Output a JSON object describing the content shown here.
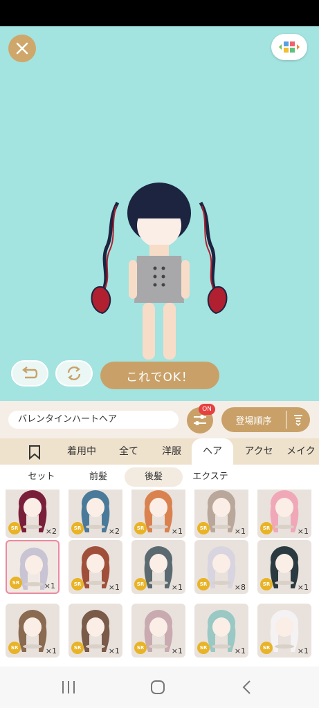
{
  "colors": {
    "stage_bg": "#a3e3e0",
    "gold": "#c9a168",
    "panel_bg": "#f5eee6",
    "sr_badge": "#e8b326",
    "on_badge": "#e64040"
  },
  "stage": {
    "close_icon": "close-icon",
    "catalog_icon": "palette-icon",
    "undo_icon": "undo-icon",
    "reset_icon": "refresh-icon",
    "ok_label": "これでOK！"
  },
  "toolbar": {
    "item_name": "バレンタインハートヘア",
    "filter_badge": "ON",
    "sort_label": "登場順序"
  },
  "category_tabs": [
    {
      "label": "",
      "icon": "bookmark-icon"
    },
    {
      "label": "着用中"
    },
    {
      "label": "全て"
    },
    {
      "label": "洋服"
    },
    {
      "label": "ヘア"
    },
    {
      "label": "アクセ"
    },
    {
      "label": "メイク"
    }
  ],
  "sub_tabs": [
    {
      "label": "セット"
    },
    {
      "label": "前髪"
    },
    {
      "label": "後髪"
    },
    {
      "label": "エクステ"
    }
  ],
  "items": [
    {
      "rarity": "SR",
      "qty": "×2",
      "hair": "#7a1f3a"
    },
    {
      "rarity": "SR",
      "qty": "×2",
      "hair": "#4a7a9a"
    },
    {
      "rarity": "SR",
      "qty": "×1",
      "hair": "#d9824f"
    },
    {
      "rarity": "SR",
      "qty": "×1",
      "hair": "#b8a79a"
    },
    {
      "rarity": "SR",
      "qty": "×1",
      "hair": "#f0a8b8"
    },
    {
      "rarity": "SR",
      "qty": "×1",
      "hair": "#c9c4d4"
    },
    {
      "rarity": "SR",
      "qty": "×1",
      "hair": "#a0503a"
    },
    {
      "rarity": "SR",
      "qty": "×1",
      "hair": "#5a6a70"
    },
    {
      "rarity": "SR",
      "qty": "×8",
      "hair": "#d8d4e0"
    },
    {
      "rarity": "SR",
      "qty": "×1",
      "hair": "#2a3a40"
    },
    {
      "rarity": "SR",
      "qty": "×1",
      "hair": "#8a6a50"
    },
    {
      "rarity": "SR",
      "qty": "×1",
      "hair": "#7a5a48"
    },
    {
      "rarity": "SR",
      "qty": "×1",
      "hair": "#c8aab0"
    },
    {
      "rarity": "SR",
      "qty": "×1",
      "hair": "#9ac8c4"
    },
    {
      "rarity": "SR",
      "qty": "×1",
      "hair": "#f4f2f2"
    }
  ],
  "navbar": {
    "recents_icon": "recents-icon",
    "home_icon": "home-icon",
    "back_icon": "back-icon"
  }
}
